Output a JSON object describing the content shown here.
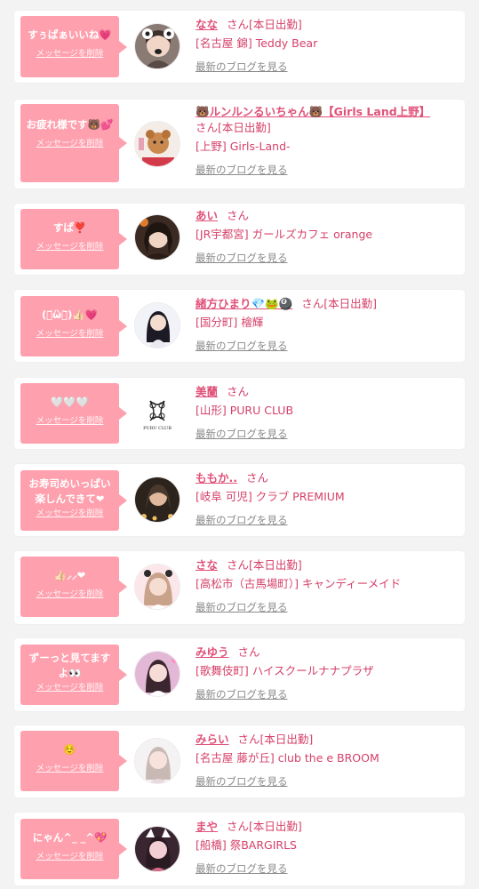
{
  "colors": {
    "bubble": "#ffa0ae",
    "accent": "#e0527a",
    "link_gray": "#8a8a8a",
    "background": "#f3f3f3"
  },
  "delete_label": "メッセージを削除",
  "blog_label": "最新のブログを見る",
  "items": [
    {
      "message": "すぅぱぁいいね💗",
      "name": "なな",
      "honorific": "さん",
      "status": "[本日出勤]",
      "shop": "[名古屋 錦] Teddy Bear",
      "avatar_icon": "girl-photo-avatar"
    },
    {
      "message": "お疲れ様です🐻💕",
      "name": "🐻ルンルンるいちゃん🐻【Girls Land上野】",
      "honorific": "さん",
      "status": "[本日出勤]",
      "shop": "[上野] Girls-Land-",
      "avatar_icon": "girl-photo-avatar"
    },
    {
      "message": "すぱ❣️",
      "name": "あい",
      "honorific": "さん",
      "status": "",
      "shop": "[JR宇都宮] ガールズカフェ orange",
      "avatar_icon": "girl-photo-avatar"
    },
    {
      "message": "(・᷄ὢ・᷅)👍🏻💗",
      "name": "緒方ひまり💎🐸🎱",
      "honorific": "さん",
      "status": "[本日出勤]",
      "shop": "[国分町] 檜輝",
      "avatar_icon": "girl-photo-avatar"
    },
    {
      "message": "🤍🤍🤍",
      "name": "美蘭",
      "honorific": "さん",
      "status": "",
      "shop": "[山形] PURU CLUB",
      "avatar_icon": "puru-club-logo",
      "logo_text": "PURU CLUB"
    },
    {
      "message": "お寿司めいっぱい楽しんできて❤︎",
      "name": "ももか..",
      "honorific": "さん",
      "status": "",
      "shop": "[岐阜 可児] クラブ PREMIUM",
      "avatar_icon": "girl-photo-avatar"
    },
    {
      "message": "👍🏻⸝⸝❤︎",
      "name": "さな",
      "honorific": "さん",
      "status": "[本日出勤]",
      "shop": "[高松市（古馬場町）] キャンディーメイド",
      "avatar_icon": "girl-photo-avatar"
    },
    {
      "message": "ずーっと見てますよ👀",
      "name": "みゆう",
      "honorific": "さん",
      "status": "",
      "shop": "[歌舞伎町] ハイスクールナナプラザ",
      "avatar_icon": "girl-photo-avatar"
    },
    {
      "message": "☺️",
      "name": "みらい",
      "honorific": "さん",
      "status": "[本日出勤]",
      "shop": "[名古屋 藤が丘] club the e BROOM",
      "avatar_icon": "girl-photo-avatar"
    },
    {
      "message": "にゃん^_ _^💖",
      "name": "まや",
      "honorific": "さん",
      "status": "[本日出勤]",
      "shop": "[船橋] 祭BARGIRLS",
      "avatar_icon": "girl-photo-avatar"
    }
  ]
}
